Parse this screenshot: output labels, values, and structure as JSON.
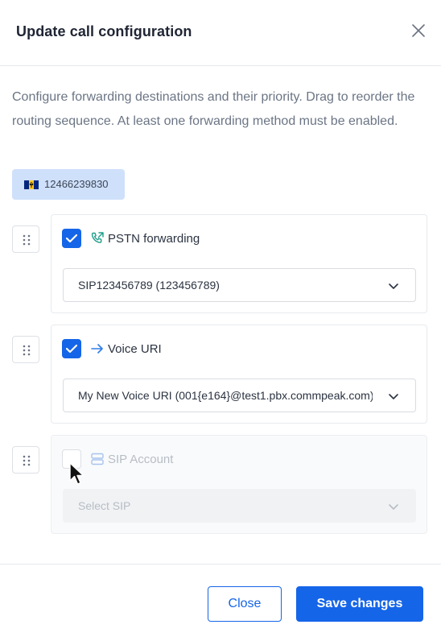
{
  "dialog": {
    "title": "Update call configuration",
    "description": "Configure forwarding destinations and their priority. Drag to reorder the routing sequence. At least one forwarding method must be enabled."
  },
  "number_chip": {
    "flag_icon": "barbados-flag-icon",
    "number": "12466239830"
  },
  "options": [
    {
      "label": "PSTN forwarding",
      "icon": "phone-forward-icon",
      "checked": true,
      "select_value": "SIP123456789 (123456789)"
    },
    {
      "label": "Voice URI",
      "icon": "arrow-right-icon",
      "checked": true,
      "select_value": "My New Voice URI (001{e164}@test1.pbx.commpeak.com)"
    },
    {
      "label": "SIP Account",
      "icon": "server-icon",
      "checked": false,
      "select_placeholder": "Select SIP"
    }
  ],
  "footer": {
    "close_label": "Close",
    "save_label": "Save changes"
  },
  "colors": {
    "primary": "#1565e8",
    "chip_bg": "#cfe0fb",
    "phone_icon": "#1f9e8a",
    "uri_icon": "#2f7de8"
  }
}
